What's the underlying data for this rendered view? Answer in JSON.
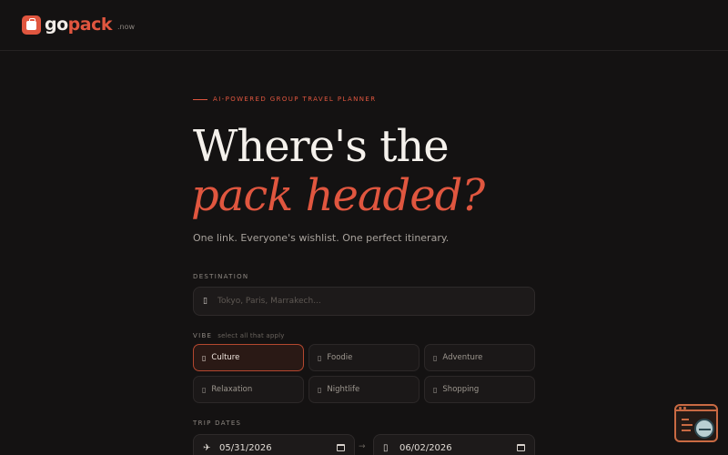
{
  "brand": {
    "go": "go",
    "pack": "pack",
    "tld": ".now"
  },
  "hero": {
    "eyebrow": "AI-POWERED GROUP TRAVEL PLANNER",
    "headline_line1": "Where's the",
    "headline_line2": "pack headed?",
    "subtitle": "One link. Everyone's wishlist. One perfect itinerary."
  },
  "destination": {
    "label": "DESTINATION",
    "icon": "location-pin-icon",
    "placeholder": "Tokyo, Paris, Marrakech..."
  },
  "vibe": {
    "label": "VIBE",
    "hint": "select all that apply",
    "options": [
      {
        "label": "Culture",
        "selected": true
      },
      {
        "label": "Foodie",
        "selected": false
      },
      {
        "label": "Adventure",
        "selected": false
      },
      {
        "label": "Relaxation",
        "selected": false
      },
      {
        "label": "Nightlife",
        "selected": false
      },
      {
        "label": "Shopping",
        "selected": false
      }
    ]
  },
  "dates": {
    "label": "TRIP DATES",
    "start": "05/31/2026",
    "end": "06/02/2026",
    "start_icon": "plane-icon",
    "end_icon": "landing-icon"
  },
  "colors": {
    "accent": "#e0563f",
    "background": "#141212"
  }
}
